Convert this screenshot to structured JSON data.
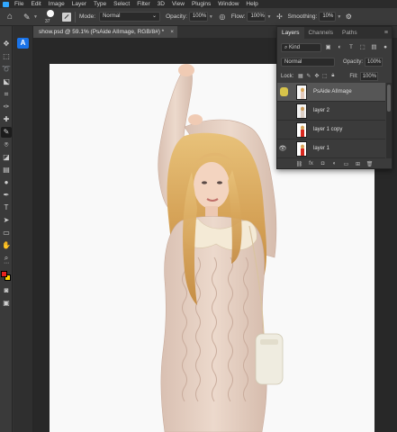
{
  "menu": [
    "File",
    "Edit",
    "Image",
    "Layer",
    "Type",
    "Select",
    "Filter",
    "3D",
    "View",
    "Plugins",
    "Window",
    "Help"
  ],
  "options": {
    "brush_size": "37",
    "mode_label": "Mode:",
    "mode_value": "Normal",
    "opacity_label": "Opacity:",
    "opacity_value": "100%",
    "flow_label": "Flow:",
    "flow_value": "100%",
    "smoothing_label": "Smoothing:",
    "smoothing_value": "10%"
  },
  "document": {
    "tab_title": "show.psd @ 59.1% (PsAide AIImage, RGB/8#) *",
    "close": "×"
  },
  "context_button": "A",
  "layers_panel": {
    "tabs": [
      "Layers",
      "Channels",
      "Paths"
    ],
    "filter_kind": "Kind",
    "blend_mode": "Normal",
    "opacity_label": "Opacity:",
    "opacity_value": "100%",
    "lock_label": "Lock:",
    "fill_label": "Fill:",
    "fill_value": "100%",
    "layers": [
      {
        "name": "PsAide AIImage",
        "visible": false,
        "selected": true
      },
      {
        "name": "layer 2",
        "visible": false,
        "selected": false
      },
      {
        "name": "layer 1 copy",
        "visible": false,
        "selected": false
      },
      {
        "name": "layer 1",
        "visible": true,
        "selected": false
      }
    ]
  },
  "colors": {
    "foreground": "#e8231f",
    "background": "#ffd200",
    "accent": "#31a8ff"
  }
}
